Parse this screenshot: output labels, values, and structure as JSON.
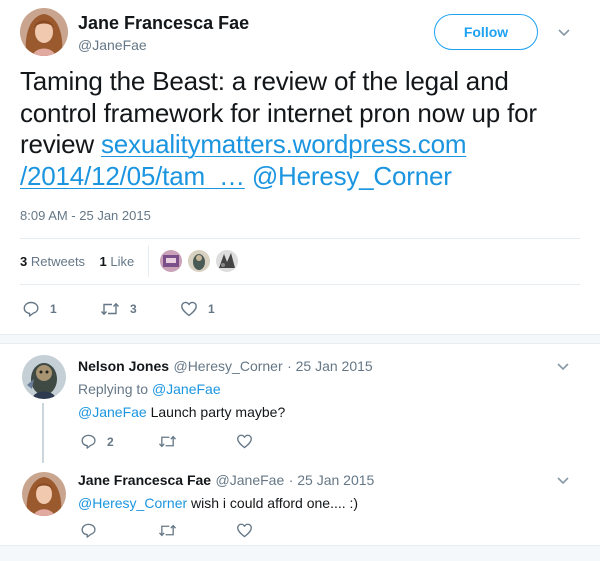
{
  "main_tweet": {
    "author_name": "Jane Francesca Fae",
    "author_handle": "@JaneFae",
    "follow_label": "Follow",
    "text_plain": "Taming the Beast: a review of the legal and control framework for internet pron now up for review ",
    "link_line1": "sexualitymatters.wordpress.com",
    "link_line2": "/2014/12/05/tam",
    "link_ellipsis": "…",
    "mention": "@Heresy_Corner",
    "timestamp": "8:09 AM - 25 Jan 2015",
    "retweets_count": "3",
    "retweets_label": "Retweets",
    "likes_count": "1",
    "likes_label": "Like",
    "actions": {
      "replies": "1",
      "retweets": "3",
      "likes": "1"
    }
  },
  "replies": [
    {
      "author_name": "Nelson Jones",
      "author_handle": "@Heresy_Corner",
      "date": "· 25 Jan 2015",
      "replying_to_label": "Replying to",
      "replying_to_handle": "@JaneFae",
      "mention": "@JaneFae",
      "text": " Launch party maybe?",
      "actions": {
        "replies": "2",
        "retweets": "",
        "likes": ""
      }
    },
    {
      "author_name": "Jane Francesca Fae",
      "author_handle": "@JaneFae",
      "date": "· 25 Jan 2015",
      "mention": "@Heresy_Corner",
      "text": " wish i could afford one.... :)",
      "actions": {
        "replies": "",
        "retweets": "",
        "likes": ""
      }
    }
  ],
  "colors": {
    "link_blue": "#1b95e0",
    "follow_blue": "#1da1f2",
    "secondary_text": "#657786",
    "divider": "#e6ecf0"
  },
  "icons": [
    "chevron-down-icon",
    "reply-icon",
    "retweet-icon",
    "like-icon"
  ]
}
